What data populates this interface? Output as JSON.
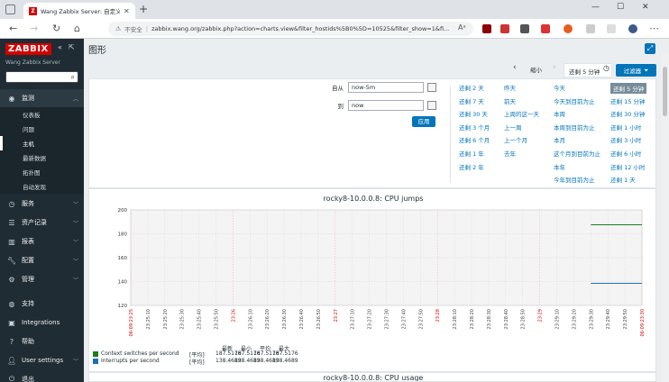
{
  "browser": {
    "tab_title": "Wang Zabbix Server: 自定义图表",
    "favicon_letter": "Z",
    "insecure_label": "不安全",
    "url": "zabbix.wang.org/zabbix.php?action=charts.view&filter_hostids%5B0%5D=10525&filter_show=1&fi...",
    "new_tab": "+",
    "win_min": "—",
    "win_max": "☐",
    "win_close": "✕"
  },
  "sidebar": {
    "logo": "ZABBIX",
    "server_name": "Wang Zabbix Server",
    "sections": [
      {
        "label": "监测",
        "icon": "eye-icon"
      },
      {
        "label": "服务",
        "icon": "clock-icon"
      },
      {
        "label": "资产记录",
        "icon": "list-icon"
      },
      {
        "label": "报表",
        "icon": "bar-chart-icon"
      },
      {
        "label": "配置",
        "icon": "wrench-icon"
      },
      {
        "label": "管理",
        "icon": "gear-icon"
      }
    ],
    "monitoring_items": [
      "仪表板",
      "问题",
      "主机",
      "最新数据",
      "拓扑图",
      "自动发现"
    ],
    "bottom": [
      {
        "label": "支持",
        "icon": "headset-icon"
      },
      {
        "label": "Integrations",
        "icon": "z-icon"
      },
      {
        "label": "帮助",
        "icon": "help-icon"
      },
      {
        "label": "User settings",
        "icon": "user-icon"
      },
      {
        "label": "退出",
        "icon": "power-icon"
      }
    ]
  },
  "page": {
    "title": "图形",
    "timebar": {
      "prev": "‹",
      "zoom_out": "缩小",
      "next": "›",
      "current": "还剩 5 分钟",
      "filter_button": "过滤器"
    },
    "filter": {
      "from_label": "自从",
      "from_value": "now-5m",
      "to_label": "到",
      "to_value": "now",
      "apply": "应用",
      "quick_columns": [
        [
          "还剩 2 天",
          "还剩 7 天",
          "还剩 30 天",
          "还剩 3 个月",
          "还剩 6 个月",
          "还剩 1 年",
          "还剩 2 年"
        ],
        [
          "昨天",
          "前天",
          "上周的这一天",
          "上一周",
          "上一个月",
          "去年"
        ],
        [
          "今天",
          "今天到目前为止",
          "本周",
          "本周到目前为止",
          "本月",
          "这个月到目前为止",
          "本年",
          "今年到目前为止"
        ],
        [
          "还剩 5 分钟",
          "还剩 15 分钟",
          "还剩 30 分钟",
          "还剩 1 小时",
          "还剩 3 小时",
          "还剩 6 小时",
          "还剩 12 小时",
          "还剩 1 天"
        ]
      ],
      "selected": "还剩 5 分钟"
    }
  },
  "chart_data": {
    "type": "line",
    "title": "rocky8-10.0.0.8: CPU jumps",
    "ylim": [
      120,
      200
    ],
    "y_ticks": [
      "200",
      "180",
      "160",
      "140",
      "120"
    ],
    "x_ticks": [
      {
        "label": "06-09 23:25",
        "red": true
      },
      {
        "label": "23:25:10",
        "red": false
      },
      {
        "label": "23:25:20",
        "red": false
      },
      {
        "label": "23:25:30",
        "red": false
      },
      {
        "label": "23:25:40",
        "red": false
      },
      {
        "label": "23:25:50",
        "red": false
      },
      {
        "label": "23:26",
        "red": true
      },
      {
        "label": "23:26:10",
        "red": false
      },
      {
        "label": "23:26:20",
        "red": false
      },
      {
        "label": "23:26:30",
        "red": false
      },
      {
        "label": "23:26:40",
        "red": false
      },
      {
        "label": "23:26:50",
        "red": false
      },
      {
        "label": "23:27",
        "red": true
      },
      {
        "label": "23:27:10",
        "red": false
      },
      {
        "label": "23:27:20",
        "red": false
      },
      {
        "label": "23:27:30",
        "red": false
      },
      {
        "label": "23:27:40",
        "red": false
      },
      {
        "label": "23:27:50",
        "red": false
      },
      {
        "label": "23:28",
        "red": true
      },
      {
        "label": "23:28:10",
        "red": false
      },
      {
        "label": "23:28:20",
        "red": false
      },
      {
        "label": "23:28:30",
        "red": false
      },
      {
        "label": "23:28:40",
        "red": false
      },
      {
        "label": "23:28:50",
        "red": false
      },
      {
        "label": "23:29",
        "red": true
      },
      {
        "label": "23:29:10",
        "red": false
      },
      {
        "label": "23:29:20",
        "red": false
      },
      {
        "label": "23:29:30",
        "red": false
      },
      {
        "label": "23:29:40",
        "red": false
      },
      {
        "label": "23:29:50",
        "red": false
      },
      {
        "label": "06-09 23:30",
        "red": true
      }
    ],
    "series": [
      {
        "name": "Context switches per second",
        "color": "#1a7d1a",
        "x_start": 27,
        "x_end": 30,
        "value": 187.5176
      },
      {
        "name": "Interrupts per second",
        "color": "#1e6fb0",
        "x_start": 27,
        "x_end": 30,
        "value": 138.4689
      }
    ],
    "legend": {
      "headers": [
        "最新",
        "最小",
        "平均",
        "最大"
      ],
      "rows": [
        {
          "name": "Context switches per second",
          "func": "[平均]",
          "values": [
            "187.5176",
            "187.5176",
            "187.5176",
            "187.5176"
          ],
          "color": "#1a7d1a"
        },
        {
          "name": "Interrupts per second",
          "func": "[平均]",
          "values": [
            "138.4689",
            "138.4689",
            "138.4689",
            "138.4689"
          ],
          "color": "#1e6fb0"
        }
      ]
    }
  },
  "next_graph_title": "rocky8-10.0.0.8: CPU usage"
}
